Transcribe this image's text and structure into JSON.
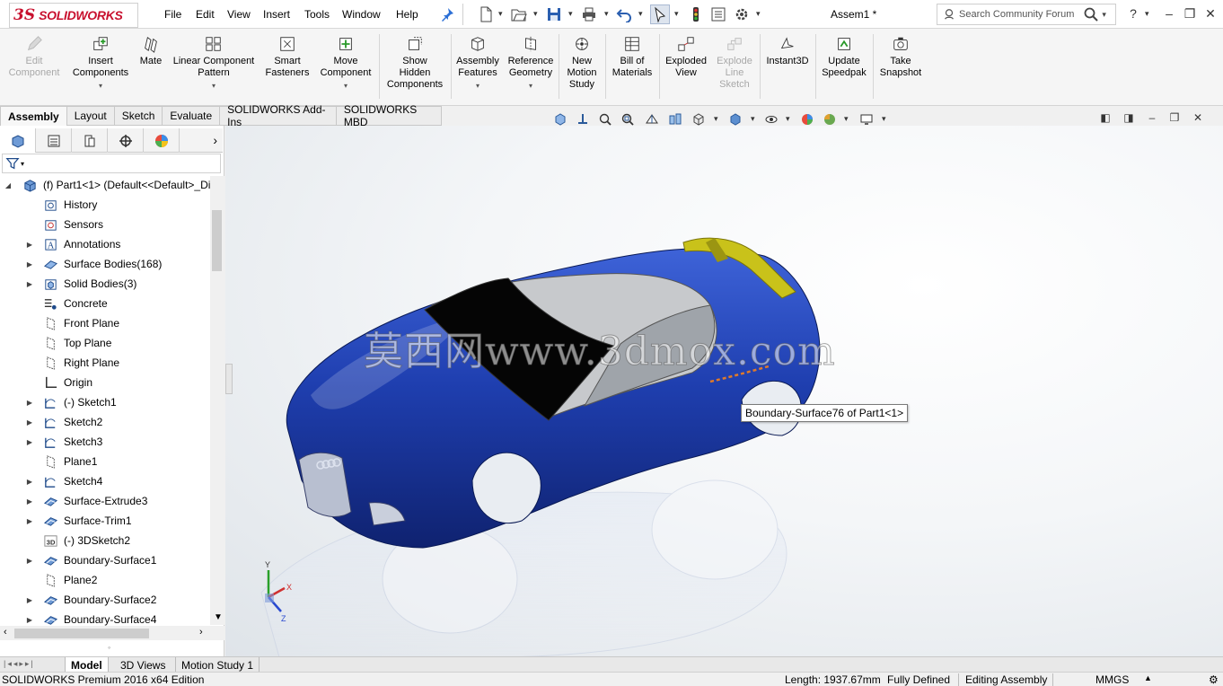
{
  "app": {
    "logo_ds": "3S",
    "logo_name": "SOLIDWORKS",
    "doc_title": "Assem1 *"
  },
  "menu": [
    "File",
    "Edit",
    "View",
    "Insert",
    "Tools",
    "Window",
    "Help"
  ],
  "search": {
    "placeholder": "Search Community Forum"
  },
  "help_label": "?",
  "commands": [
    {
      "l1": "Edit",
      "l2": "Component",
      "enabled": false,
      "icon": "edit-component-icon"
    },
    {
      "l1": "Insert",
      "l2": "Components",
      "enabled": true,
      "icon": "insert-components-icon"
    },
    {
      "l1": "Mate",
      "l2": "",
      "enabled": true,
      "icon": "mate-icon"
    },
    {
      "l1": "Linear Component",
      "l2": "Pattern",
      "enabled": true,
      "icon": "linear-pattern-icon"
    },
    {
      "l1": "Smart",
      "l2": "Fasteners",
      "enabled": true,
      "icon": "smart-fasteners-icon"
    },
    {
      "l1": "Move",
      "l2": "Component",
      "enabled": true,
      "icon": "move-component-icon"
    },
    {
      "l1": "Show",
      "l2": "Hidden",
      "l3": "Components",
      "enabled": true,
      "icon": "show-hidden-icon"
    },
    {
      "l1": "Assembly",
      "l2": "Features",
      "enabled": true,
      "icon": "assembly-features-icon"
    },
    {
      "l1": "Reference",
      "l2": "Geometry",
      "enabled": true,
      "icon": "reference-geometry-icon"
    },
    {
      "l1": "New",
      "l2": "Motion",
      "l3": "Study",
      "enabled": true,
      "icon": "motion-study-icon"
    },
    {
      "l1": "Bill of",
      "l2": "Materials",
      "enabled": true,
      "icon": "bom-icon"
    },
    {
      "l1": "Exploded",
      "l2": "View",
      "enabled": true,
      "icon": "exploded-view-icon"
    },
    {
      "l1": "Explode",
      "l2": "Line",
      "l3": "Sketch",
      "enabled": false,
      "icon": "explode-line-icon"
    },
    {
      "l1": "Instant3D",
      "l2": "",
      "enabled": true,
      "icon": "instant3d-icon"
    },
    {
      "l1": "Update",
      "l2": "Speedpak",
      "enabled": true,
      "icon": "speedpak-icon"
    },
    {
      "l1": "Take",
      "l2": "Snapshot",
      "enabled": true,
      "icon": "snapshot-icon"
    }
  ],
  "tabs": [
    "Assembly",
    "Layout",
    "Sketch",
    "Evaluate",
    "SOLIDWORKS Add-Ins",
    "SOLIDWORKS MBD"
  ],
  "active_tab": "Assembly",
  "tree": {
    "root": "(f) Part1<1> (Default<<Default>_Di",
    "items": [
      {
        "label": "History",
        "icon": "history-icon",
        "expandable": false
      },
      {
        "label": "Sensors",
        "icon": "sensors-icon",
        "expandable": false
      },
      {
        "label": "Annotations",
        "icon": "annotations-icon",
        "expandable": true
      },
      {
        "label": "Surface Bodies(168)",
        "icon": "surface-bodies-icon",
        "expandable": true
      },
      {
        "label": "Solid Bodies(3)",
        "icon": "solid-bodies-icon",
        "expandable": true
      },
      {
        "label": "Concrete",
        "icon": "material-icon",
        "expandable": false
      },
      {
        "label": "Front Plane",
        "icon": "plane-icon",
        "expandable": false
      },
      {
        "label": "Top Plane",
        "icon": "plane-icon",
        "expandable": false
      },
      {
        "label": "Right Plane",
        "icon": "plane-icon",
        "expandable": false
      },
      {
        "label": "Origin",
        "icon": "origin-icon",
        "expandable": false
      },
      {
        "label": "(-) Sketch1",
        "icon": "sketch-icon",
        "expandable": true
      },
      {
        "label": "Sketch2",
        "icon": "sketch-icon",
        "expandable": true
      },
      {
        "label": "Sketch3",
        "icon": "sketch-icon",
        "expandable": true
      },
      {
        "label": "Plane1",
        "icon": "plane-icon",
        "expandable": false
      },
      {
        "label": "Sketch4",
        "icon": "sketch-icon",
        "expandable": true
      },
      {
        "label": "Surface-Extrude3",
        "icon": "surface-feature-icon",
        "expandable": true
      },
      {
        "label": "Surface-Trim1",
        "icon": "surface-feature-icon",
        "expandable": true
      },
      {
        "label": "(-) 3DSketch2",
        "icon": "3dsketch-icon",
        "expandable": false,
        "icon_text": "3D"
      },
      {
        "label": "Boundary-Surface1",
        "icon": "surface-feature-icon",
        "expandable": true
      },
      {
        "label": "Plane2",
        "icon": "plane-icon",
        "expandable": false
      },
      {
        "label": "Boundary-Surface2",
        "icon": "surface-feature-icon",
        "expandable": true
      },
      {
        "label": "Boundary-Surface4",
        "icon": "surface-feature-icon",
        "expandable": true
      }
    ]
  },
  "viewport": {
    "tooltip": "Boundary-Surface76 of Part1<1>",
    "watermark": "莫西网www.3dmox.com",
    "body_color": "#1f3fb0",
    "spoiler_color": "#c9c21a",
    "glass_color": "#050505",
    "triad": {
      "x": "X",
      "y": "Y",
      "z": "Z"
    }
  },
  "bottom_tabs": [
    "Model",
    "3D Views",
    "Motion Study 1"
  ],
  "active_bottom_tab": "Model",
  "status": {
    "edition": "SOLIDWORKS Premium 2016 x64 Edition",
    "length": "Length: 1937.67mm",
    "state": "Fully Defined",
    "mode": "Editing Assembly",
    "units": "MMGS"
  }
}
